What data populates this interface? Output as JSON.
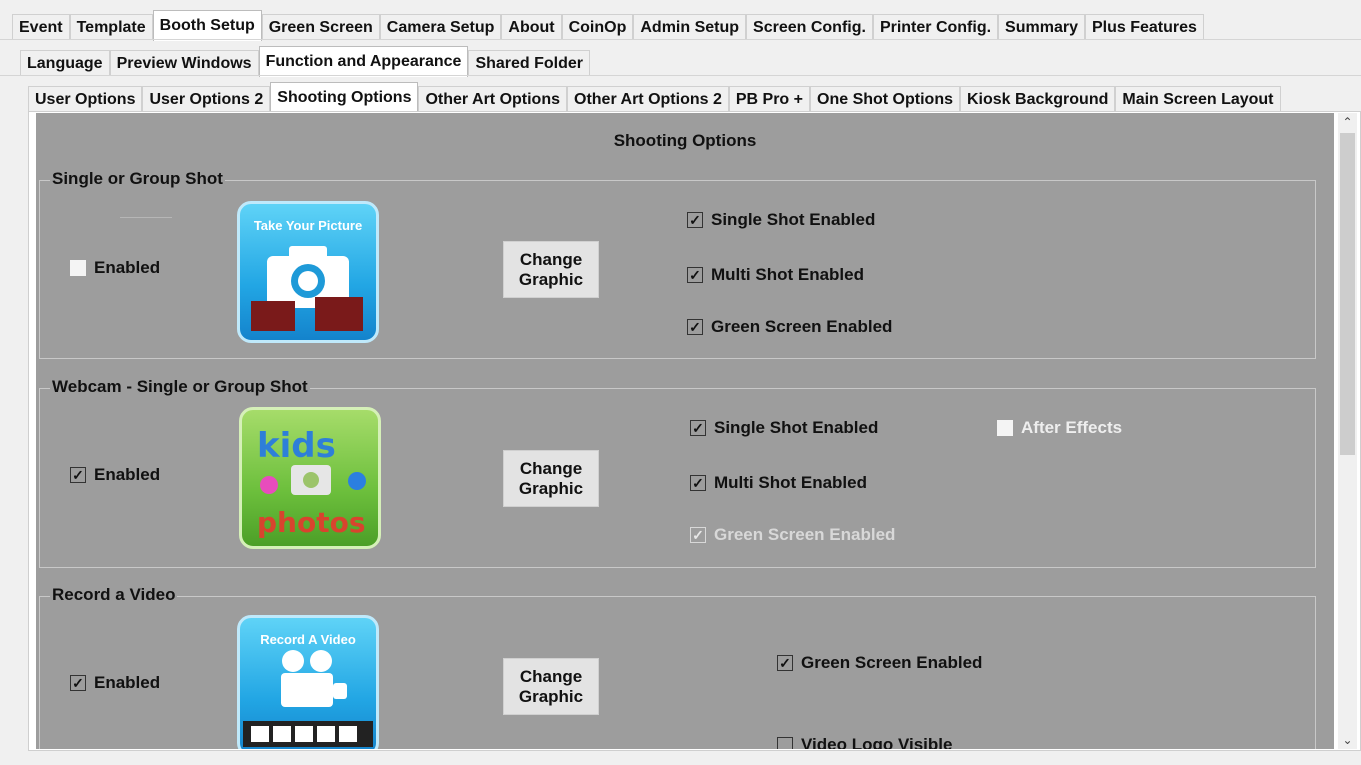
{
  "tabs_row1": [
    "Event",
    "Template",
    "Booth Setup",
    "Green Screen",
    "Camera Setup",
    "About",
    "CoinOp",
    "Admin Setup",
    "Screen Config.",
    "Printer Config.",
    "Summary",
    "Plus Features"
  ],
  "tabs_row1_active": 2,
  "tabs_row2": [
    "Language",
    "Preview Windows",
    "Function and Appearance",
    "Shared Folder"
  ],
  "tabs_row2_active": 2,
  "tabs_row3": [
    "User Options",
    "User Options 2",
    "Shooting Options",
    "Other Art Options",
    "Other Art Options 2",
    "PB Pro +",
    "One Shot Options",
    "Kiosk Background",
    "Main Screen Layout"
  ],
  "tabs_row3_active": 2,
  "panel_title": "Shooting Options",
  "groups": {
    "single_group": {
      "label": "Single or Group Shot",
      "enabled_label": "Enabled",
      "enabled_checked": false,
      "thumb_caption": "Take Your Picture",
      "change_label": "Change\nGraphic",
      "single_label": "Single Shot Enabled",
      "single_checked": true,
      "multi_label": "Multi Shot Enabled",
      "multi_checked": true,
      "green_label": "Green Screen Enabled",
      "green_checked": true
    },
    "webcam": {
      "label": "Webcam - Single or Group Shot",
      "enabled_label": "Enabled",
      "enabled_checked": true,
      "change_label": "Change\nGraphic",
      "single_label": "Single Shot Enabled",
      "single_checked": true,
      "multi_label": "Multi Shot Enabled",
      "multi_checked": true,
      "green_label": "Green Screen Enabled",
      "green_checked": true,
      "after_label": "After Effects",
      "after_checked": false
    },
    "video": {
      "label": "Record a Video",
      "enabled_label": "Enabled",
      "enabled_checked": true,
      "thumb_caption": "Record A Video",
      "change_label": "Change\nGraphic",
      "green_label": "Green Screen Enabled",
      "green_checked": true,
      "logo_label": "Video Logo Visible",
      "logo_checked": false
    }
  },
  "check_mark": "✓",
  "scroll_up_glyph": "⌃",
  "scroll_down_glyph": "⌄",
  "colors": {
    "panel_bg": "#9d9d9d",
    "tab_bg": "#f0f0f0"
  }
}
